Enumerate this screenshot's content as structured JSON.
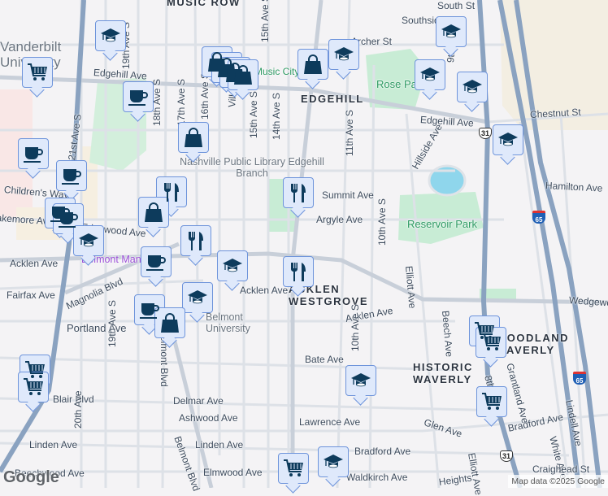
{
  "map": {
    "neighborhoods": [
      "MUSIC ROW",
      "EDGEHILL",
      "ACKLEN WESTGROVE",
      "HISTORIC WAVERLY",
      "WOODLAND WAVERLY"
    ],
    "parks": [
      "Rose Park",
      "Reservoir Park"
    ],
    "pois": [
      "Vanderbilt University",
      "Nashville Public Library Edgehill Branch",
      "Belmont University",
      "Belmont Mansion",
      "Music City"
    ],
    "streets": [
      "South St",
      "Southside",
      "Archer St",
      "Edgehill Ave",
      "Chestnut St",
      "Hamilton Ave",
      "Summit Ave",
      "Argyle Ave",
      "Acklen Ave",
      "Wedgewood Ave",
      "Magnolia Blvd",
      "Fairfax Ave",
      "Portland Ave",
      "Bate Ave",
      "Blair Blvd",
      "Delmar Ave",
      "Ashwood Ave",
      "Lawrence Ave",
      "Glen Ave",
      "Bradford Ave",
      "Linden Ave",
      "Elmwood Ave",
      "Beechwood Ave",
      "Waldkirch Ave",
      "Children's Way",
      "Blakemore Ave",
      "Edgewood Ave",
      "21st Ave S",
      "19th Ave S",
      "18th Ave S",
      "17th Ave S",
      "16th Ave S",
      "15th Ave S",
      "14th Ave S",
      "11th Ave S",
      "10th Ave S",
      "9th Ave",
      "Villa Pl",
      "Hillside Ave",
      "Elliott Ave",
      "Beech Ave",
      "Grantland Ave",
      "Lindell Ave",
      "White Ave",
      "Belmont Blvd",
      "20th Ave",
      "8th Ave S",
      "Craighead St",
      "Heights"
    ],
    "shields": {
      "us31": "31",
      "i65": "65"
    },
    "colors": {
      "marker_fill": "#dfe9fb",
      "marker_border": "#6e94db",
      "icon": "#0d3b5c",
      "park": "#c8ecd5",
      "water": "#8fd6ec",
      "highway": "#8aa2c0"
    },
    "markers": [
      "school",
      "grocery",
      "shopping",
      "shopping",
      "school",
      "school",
      "school",
      "school",
      "school",
      "cafe",
      "shopping",
      "cafe",
      "cafe",
      "cafe",
      "cafe",
      "school",
      "restaurant",
      "shopping",
      "restaurant",
      "restaurant",
      "cafe",
      "school",
      "restaurant",
      "school",
      "cafe",
      "shopping",
      "grocery",
      "grocery",
      "school",
      "grocery",
      "grocery",
      "grocery",
      "grocery",
      "school"
    ]
  },
  "footer": {
    "logo": "Google",
    "attribution": "Map data ©2025 Google"
  }
}
